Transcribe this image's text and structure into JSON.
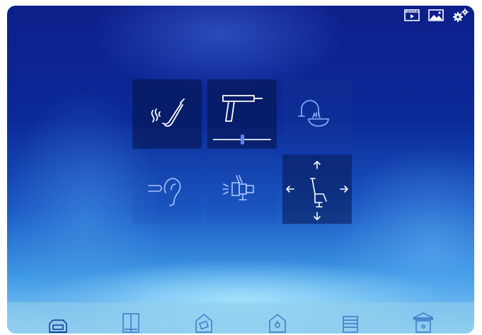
{
  "colors": {
    "background_top": "#0c1f8a",
    "background_bottom": "#8fd3f6",
    "tile_dark": "#061246",
    "icon_stroke": "#ffffff",
    "slider_knob": "#5d86ff",
    "bottom_bar": "#96cdeb"
  },
  "top_bar": {
    "icons": [
      "video-icon",
      "image-icon",
      "settings-icon"
    ]
  },
  "function_grid": {
    "tiles": [
      {
        "icon": "saliva-ejector-icon",
        "active": true
      },
      {
        "icon": "handpiece-icon",
        "active": true,
        "slider_level": 0.47
      },
      {
        "icon": "cup-filler-icon",
        "active": false
      },
      {
        "icon": "air-water-spray-icon",
        "active": false
      },
      {
        "icon": "operating-lamp-icon",
        "active": false
      },
      {
        "icon": "chair-position-icon",
        "active": true
      }
    ]
  },
  "bottom_bar": {
    "icons": [
      "mode-1-icon",
      "mode-2-icon",
      "mode-3-icon",
      "mode-4-icon",
      "mode-5-icon",
      "mode-6-icon"
    ]
  }
}
